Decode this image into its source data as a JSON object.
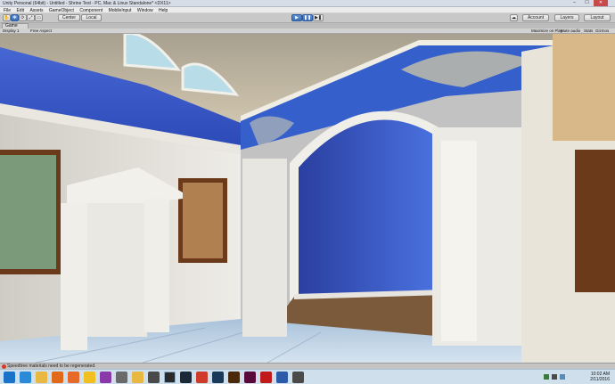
{
  "window": {
    "title": "Unity Personal (64bit) - Untitled - Shrine Test - PC, Mac & Linux Standalone* <DX11>",
    "controls": [
      "–",
      "☐",
      "✕"
    ]
  },
  "menu": [
    "File",
    "Edit",
    "Assets",
    "GameObject",
    "Component",
    "MobileInput",
    "Window",
    "Help"
  ],
  "toolbar": {
    "tools": [
      "✋",
      "✥",
      "⟳",
      "⤢",
      "▭"
    ],
    "pivot_label": "Center",
    "space_label": "Local",
    "play": "▶",
    "pause": "❚❚",
    "step": "▶❚",
    "account_label": "Account",
    "layers_label": "Layers",
    "layout_label": "Layout"
  },
  "game_tab": {
    "label": "Game",
    "display": "Display 1",
    "aspect": "Free Aspect",
    "maximize": "Maximize on Play",
    "mute": "Mute audio",
    "stats": "Stats",
    "gizmos": "Gizmos"
  },
  "status": {
    "message": "Speedtree materials need to be regenerated."
  },
  "taskbar": {
    "apps": [
      {
        "name": "start-button",
        "color": "#1a73c9"
      },
      {
        "name": "ie",
        "color": "#2a8ad8"
      },
      {
        "name": "explorer",
        "color": "#e8b842"
      },
      {
        "name": "media-player",
        "color": "#e06a1a"
      },
      {
        "name": "firefox",
        "color": "#e86a2a"
      },
      {
        "name": "chrome",
        "color": "#f0c020"
      },
      {
        "name": "onenote",
        "color": "#8a3aa8"
      },
      {
        "name": "app-7",
        "color": "#6a6a6a"
      },
      {
        "name": "folder",
        "color": "#e8b842"
      },
      {
        "name": "calculator",
        "color": "#4a4a4a"
      },
      {
        "name": "unity",
        "color": "#2a2a2a"
      },
      {
        "name": "steam",
        "color": "#1b2838"
      },
      {
        "name": "app-12",
        "color": "#d03a2a"
      },
      {
        "name": "photoshop",
        "color": "#1b3a5a"
      },
      {
        "name": "illustrator",
        "color": "#4a2a0a"
      },
      {
        "name": "indesign",
        "color": "#5a0a3a"
      },
      {
        "name": "acrobat",
        "color": "#c01a1a"
      },
      {
        "name": "app-17",
        "color": "#2a5aa8"
      },
      {
        "name": "app-18",
        "color": "#4a4a4a"
      }
    ],
    "time": "10:02 AM",
    "date": "2/11/2016"
  },
  "colors": {
    "wall_blue": "#3558c8",
    "trim_white": "#e6e4df",
    "ceiling": "#c8bca6",
    "floor": "#b9cfe2",
    "wood_floor": "#7a5a3a",
    "error_red": "#d23a2a"
  }
}
